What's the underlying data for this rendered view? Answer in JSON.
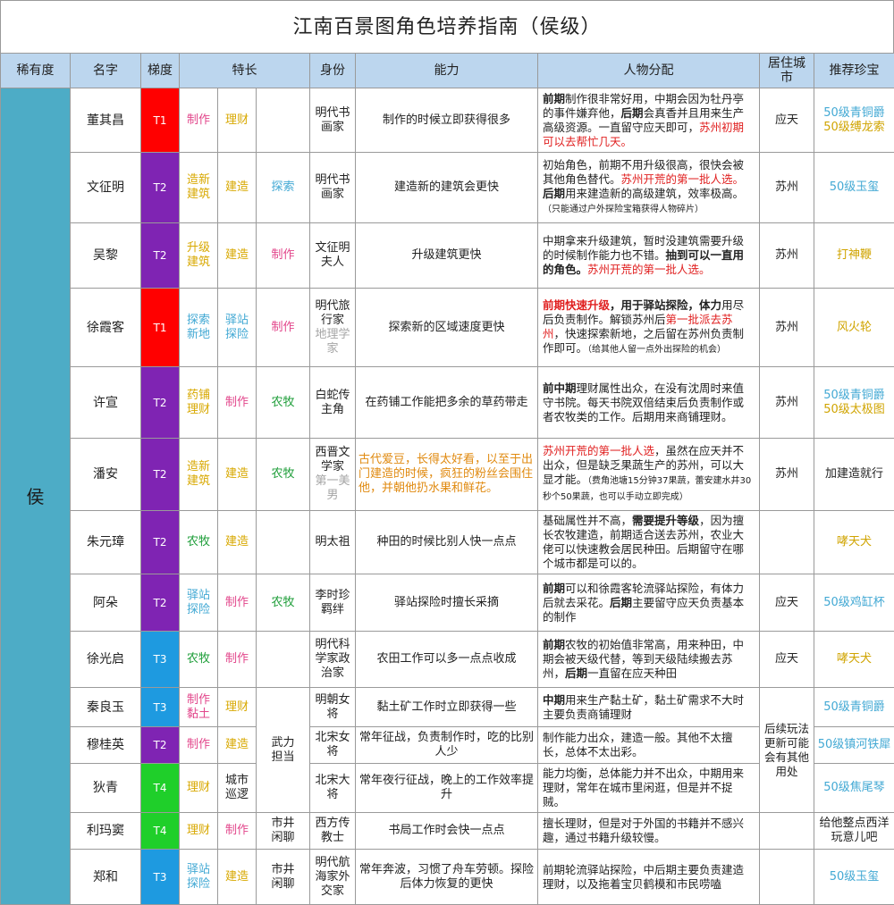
{
  "title": "江南百景图角色培养指南（侯级）",
  "headers": [
    "稀有度",
    "名字",
    "梯度",
    "特长",
    "身份",
    "能力",
    "人物分配",
    "居住城市",
    "推荐珍宝"
  ],
  "rarity": "侯",
  "colors": {
    "T1": "#ff0000",
    "T2": "#7f24b3",
    "T3": "#1e9ae0",
    "T4": "#1fcf2a"
  },
  "merged": {
    "wuli": "武力担当",
    "city_later": "后续玩法更新可能会有其他用处"
  },
  "rows": [
    {
      "name": "董其昌",
      "tier": "T1",
      "skills": [
        "制作",
        "理财",
        ""
      ],
      "role": [
        [
          "明代书画家",
          ""
        ]
      ],
      "ability": [
        [
          "制作的时候立即获得很多",
          ""
        ]
      ],
      "desc": [
        [
          "前期",
          "bold"
        ],
        [
          "制作很非常好用，中期会因为牡丹亭的事件嫌弃他，",
          ""
        ],
        [
          "后期",
          "bold"
        ],
        [
          "会真香并且用来生产高级资源。一直留守应天即可，",
          ""
        ],
        [
          "苏州初期可以去帮忙几天。",
          "red"
        ]
      ],
      "city": "应天",
      "treasure": [
        [
          "50级青铜爵",
          "blue"
        ],
        [
          "50级缚龙索",
          "yellow"
        ]
      ]
    },
    {
      "name": "文征明",
      "tier": "T2",
      "skills": [
        "造新建筑",
        "建造",
        "探索"
      ],
      "role": [
        [
          "明代书画家",
          ""
        ]
      ],
      "ability": [
        [
          "建造新的建筑会更快",
          ""
        ]
      ],
      "desc": [
        [
          "初始角色，前期不用升级很高，很快会被其他角色替代。",
          ""
        ],
        [
          "苏州开荒的第一批人选。",
          "red"
        ],
        [
          "后期",
          "bold"
        ],
        [
          "用来建造新的高级建筑，效率极高。",
          ""
        ],
        [
          "（只能通过户外探险宝箱获得人物碎片）",
          "small"
        ]
      ],
      "city": "苏州",
      "treasure": [
        [
          "50级玉玺",
          "blue"
        ]
      ]
    },
    {
      "name": "吴黎",
      "tier": "T2",
      "skills": [
        "升级建筑",
        "建造",
        "制作"
      ],
      "role": [
        [
          "文征明夫人",
          ""
        ]
      ],
      "ability": [
        [
          "升级建筑更快",
          ""
        ]
      ],
      "desc": [
        [
          "中期拿来升级建筑，暂时没建筑需要升级的时候制作能力也不错。",
          ""
        ],
        [
          "抽到可以一直用的角色。",
          "bold"
        ],
        [
          "苏州开荒的第一批人选。",
          "red"
        ]
      ],
      "city": "苏州",
      "treasure": [
        [
          "打神鞭",
          "yellow"
        ]
      ]
    },
    {
      "name": "徐霞客",
      "tier": "T1",
      "skills": [
        "探索新地",
        "驿站探险",
        "制作"
      ],
      "role": [
        [
          "明代旅行家",
          ""
        ],
        [
          "地理学家",
          "gray"
        ]
      ],
      "ability": [
        [
          "探索新的区域速度更快",
          ""
        ]
      ],
      "desc": [
        [
          "前期快速升级",
          "boldred"
        ],
        [
          "，用于驿站探险，体力",
          "bold"
        ],
        [
          "用尽后负责制作。解锁苏州后",
          ""
        ],
        [
          "第一批派去苏州",
          "red"
        ],
        [
          "，快速探索新地，之后留在苏州负责制作即可。",
          ""
        ],
        [
          "（给其他人留一点外出探险的机会）",
          "small"
        ]
      ],
      "city": "苏州",
      "treasure": [
        [
          "风火轮",
          "yellow"
        ]
      ]
    },
    {
      "name": "许宣",
      "tier": "T2",
      "skills": [
        "药铺理财",
        "制作",
        "农牧"
      ],
      "role": [
        [
          "白蛇传主角",
          ""
        ]
      ],
      "ability": [
        [
          "在药铺工作能把多余的草药带走",
          ""
        ]
      ],
      "desc": [
        [
          "前中期",
          "bold"
        ],
        [
          "理财属性出众，在没有沈周时来值守书院。每天书院双倍结束后负责制作或者农牧类的工作。后期用来商铺理财。",
          ""
        ]
      ],
      "city": "苏州",
      "treasure": [
        [
          "50级青铜爵",
          "blue"
        ],
        [
          "50级太极图",
          "yellow"
        ]
      ]
    },
    {
      "name": "潘安",
      "tier": "T2",
      "skills": [
        "造新建筑",
        "建造",
        "农牧"
      ],
      "role": [
        [
          "西晋文学家",
          ""
        ],
        [
          "第一美男",
          "gray"
        ]
      ],
      "ability": [
        [
          "古代爱豆，长得太好看，以至于出门建造的时候，疯狂的粉丝会围住他，并朝他扔水果和鲜花。",
          "orange"
        ]
      ],
      "desc": [
        [
          "苏州开荒的第一批人选",
          "red"
        ],
        [
          "，虽然在应天并不出众，但是缺乏果蔬生产的苏州，可以大显才能。",
          ""
        ],
        [
          "（费角池塘15分钟37果蔬，蕾安建水井30秒个50果蔬，也可以手动立即完成）",
          "small"
        ]
      ],
      "city": "苏州",
      "treasure": [
        [
          "加建造就行",
          "black"
        ]
      ]
    },
    {
      "name": "朱元璋",
      "tier": "T2",
      "skills": [
        "农牧",
        "建造",
        ""
      ],
      "role": [
        [
          "明太祖",
          ""
        ]
      ],
      "ability": [
        [
          "种田的时候比别人快一点点",
          ""
        ]
      ],
      "desc": [
        [
          "基础属性并不高，",
          ""
        ],
        [
          "需要提升等级",
          "bold"
        ],
        [
          "，因为擅长农牧建造，前期适合送去苏州，农业大佬可以快速教会居民种田。后期留守在哪个城市都是可以的。",
          ""
        ]
      ],
      "city": "",
      "treasure": [
        [
          "哮天犬",
          "yellow"
        ]
      ]
    },
    {
      "name": "阿朵",
      "tier": "T2",
      "skills": [
        "驿站探险",
        "制作",
        "农牧"
      ],
      "role": [
        [
          "李时珍羁绊",
          ""
        ]
      ],
      "ability": [
        [
          "驿站探险时擅长采摘",
          ""
        ]
      ],
      "desc": [
        [
          "前期",
          "bold"
        ],
        [
          "可以和徐霞客轮流驿站探险，有体力后就去采花。",
          ""
        ],
        [
          "后期",
          "bold"
        ],
        [
          "主要留守应天负责基本的制作",
          ""
        ]
      ],
      "city": "应天",
      "treasure": [
        [
          "50级鸡缸杯",
          "blue"
        ]
      ]
    },
    {
      "name": "徐光启",
      "tier": "T3",
      "skills": [
        "农牧",
        "制作",
        ""
      ],
      "role": [
        [
          "明代科学家政治家",
          ""
        ]
      ],
      "ability": [
        [
          "农田工作可以多一点点收成",
          ""
        ]
      ],
      "desc": [
        [
          "前期",
          "bold"
        ],
        [
          "农牧的初始值非常高，用来种田，中期会被天级代替，等到天级陆续搬去苏州，",
          ""
        ],
        [
          "后期",
          "bold"
        ],
        [
          "一直留在应天种田",
          ""
        ]
      ],
      "city": "应天",
      "treasure": [
        [
          "哮天犬",
          "yellow"
        ]
      ]
    },
    {
      "name": "秦良玉",
      "tier": "T3",
      "skills": [
        "制作黏土",
        "理财",
        ""
      ],
      "role": [
        [
          "明朝女将",
          ""
        ]
      ],
      "ability": [
        [
          "黏土矿工作时立即获得一些",
          ""
        ]
      ],
      "desc": [
        [
          "中期",
          "bold"
        ],
        [
          "用来生产黏土矿，黏土矿需求不大时主要负责商铺理财",
          ""
        ]
      ],
      "city": "",
      "treasure": [
        [
          "50级青铜爵",
          "blue"
        ]
      ]
    },
    {
      "name": "穆桂英",
      "tier": "T2",
      "skills": [
        "制作",
        "建造",
        ""
      ],
      "role": [
        [
          "北宋女将",
          ""
        ]
      ],
      "ability": [
        [
          "常年征战，负责制作时，吃的比别人少",
          ""
        ]
      ],
      "desc": [
        [
          "制作能力出众，建造一般。其他不太擅长，总体不太出彩。",
          ""
        ]
      ],
      "city": "",
      "treasure": [
        [
          "50级镇河铁犀",
          "blue"
        ]
      ]
    },
    {
      "name": "狄青",
      "tier": "T4",
      "skills": [
        "理财",
        "城市巡逻",
        ""
      ],
      "role": [
        [
          "北宋大将",
          ""
        ]
      ],
      "ability": [
        [
          "常年夜行征战，晚上的工作效率提升",
          ""
        ]
      ],
      "desc": [
        [
          "能力均衡，总体能力并不出众，中期用来理财，常年在城市里闲逛，但是并不捉贼。",
          ""
        ]
      ],
      "city": "",
      "treasure": [
        [
          "50级焦尾琴",
          "blue"
        ]
      ]
    },
    {
      "name": "利玛窦",
      "tier": "T4",
      "skills": [
        "理财",
        "制作",
        "市井闲聊"
      ],
      "role": [
        [
          "西方传教士",
          ""
        ]
      ],
      "ability": [
        [
          "书局工作时会快一点点",
          ""
        ]
      ],
      "desc": [
        [
          "擅长理财，但是对于外国的书籍并不感兴趣，通过书籍升级较慢。",
          ""
        ]
      ],
      "city": "",
      "treasure": [
        [
          "给他整点西洋玩意儿吧",
          "black"
        ]
      ]
    },
    {
      "name": "郑和",
      "tier": "T3",
      "skills": [
        "驿站探险",
        "建造",
        "市井闲聊"
      ],
      "role": [
        [
          "明代航海家外交家",
          ""
        ]
      ],
      "ability": [
        [
          "常年奔波，习惯了舟车劳顿。探险后体力恢复的更快",
          ""
        ]
      ],
      "desc": [
        [
          "前期轮流驿站探险，中后期主要负责建造理财，以及拖着宝贝鹤模和市民唠嗑",
          ""
        ]
      ],
      "city": "",
      "treasure": [
        [
          "50级玉玺",
          "blue"
        ]
      ]
    }
  ]
}
